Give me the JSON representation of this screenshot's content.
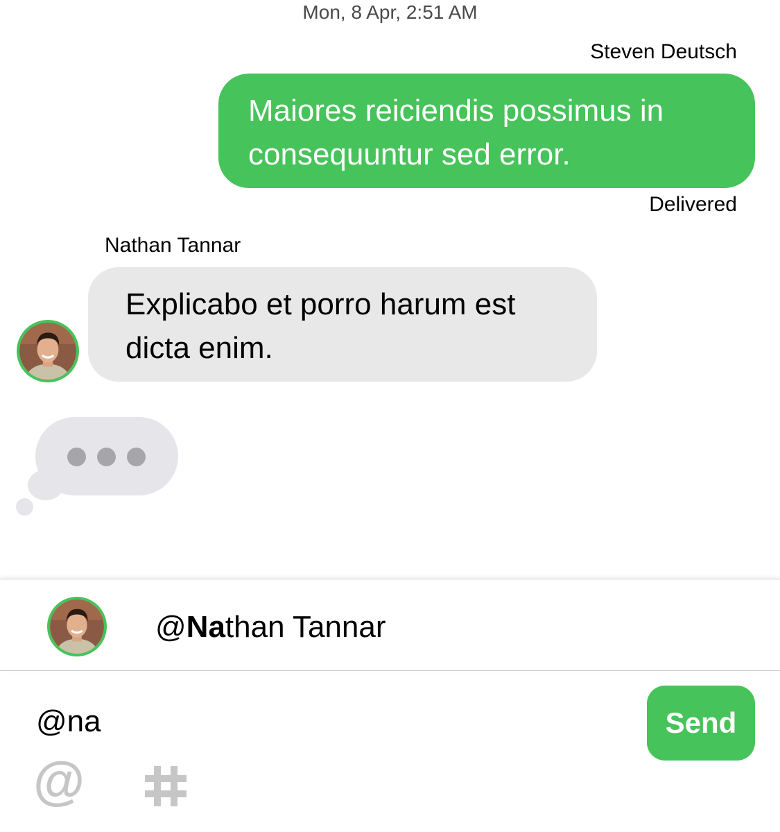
{
  "conversation": {
    "timestamp": "Mon, 8 Apr, 2:51 AM",
    "outgoing": {
      "sender": "Steven Deutsch",
      "text": "Maiores reiciendis possimus in consequuntur sed error.",
      "status": "Delivered"
    },
    "incoming": {
      "sender": "Nathan Tannar",
      "text": "Explicabo et porro harum est dicta enim."
    },
    "typing_indicator": "typing-dots"
  },
  "mention_suggestion": {
    "prefix": "@",
    "match": "Na",
    "rest": "than Tannar"
  },
  "composer": {
    "input_text": "@na",
    "send_label": "Send",
    "at_label": "@",
    "hash_icon": "hash-icon"
  },
  "colors": {
    "accent": "#46c35a",
    "incoming_bubble": "#e8e8e8",
    "typing_bubble": "#e6e6ea"
  }
}
